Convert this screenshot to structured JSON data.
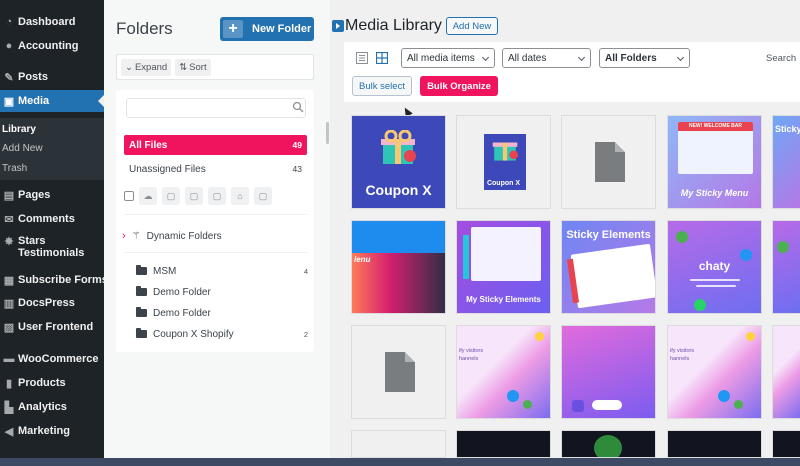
{
  "sidebar": {
    "items": [
      {
        "label": "Dashboard",
        "icon": "dashboard-icon"
      },
      {
        "label": "Accounting",
        "icon": "accounting-icon"
      },
      {
        "label": "Posts",
        "icon": "pin-icon"
      },
      {
        "label": "Media",
        "icon": "media-icon"
      },
      {
        "label": "Pages",
        "icon": "pages-icon"
      },
      {
        "label": "Comments",
        "icon": "comments-icon"
      },
      {
        "label": "Stars Testimonials",
        "icon": "stars-icon"
      },
      {
        "label": "Subscribe Forms",
        "icon": "forms-icon"
      },
      {
        "label": "DocsPress",
        "icon": "docs-icon"
      },
      {
        "label": "User Frontend",
        "icon": "user-icon"
      },
      {
        "label": "WooCommerce",
        "icon": "woo-icon"
      },
      {
        "label": "Products",
        "icon": "products-icon"
      },
      {
        "label": "Analytics",
        "icon": "analytics-icon"
      },
      {
        "label": "Marketing",
        "icon": "marketing-icon"
      }
    ],
    "media_sub": [
      "Library",
      "Add New",
      "Trash"
    ]
  },
  "folders": {
    "title": "Folders",
    "new_folder_label": "New Folder",
    "expand_label": "Expand",
    "sort_label": "Sort",
    "search_placeholder": "",
    "all_files": {
      "label": "All Files",
      "count": "49"
    },
    "unassigned": {
      "label": "Unassigned Files",
      "count": "43"
    },
    "dynamic_label": "Dynamic Folders",
    "list": [
      {
        "name": "MSM",
        "count": "4"
      },
      {
        "name": "Demo Folder",
        "count": ""
      },
      {
        "name": "Demo Folder",
        "count": ""
      },
      {
        "name": "Coupon X Shopify",
        "count": "2"
      }
    ]
  },
  "media": {
    "title": "Media Library",
    "add_new_label": "Add New",
    "filter_items": "All media items",
    "filter_dates": "All dates",
    "filter_folders": "All Folders",
    "search_label": "Search",
    "bulk_select_label": "Bulk select",
    "bulk_organize_label": "Bulk Organize",
    "tiles": {
      "coupon_x": "Coupon X",
      "coupon_x_small": "Coupon X",
      "my_sticky_menu": "My Sticky Menu",
      "welcome_bar": "NEW! WELCOME BAR",
      "sticky_partial": "Sticky",
      "sticky_elements": "Sticky Elements",
      "my_sticky_elements": "My Sticky Elements",
      "chaty": "chaty",
      "lenu": "lenu",
      "visitors": "ify visitors",
      "channels": "hannels"
    }
  },
  "colors": {
    "sidebar_bg": "#1d2327",
    "accent_blue": "#2271b1",
    "accent_pink": "#f0135e"
  }
}
